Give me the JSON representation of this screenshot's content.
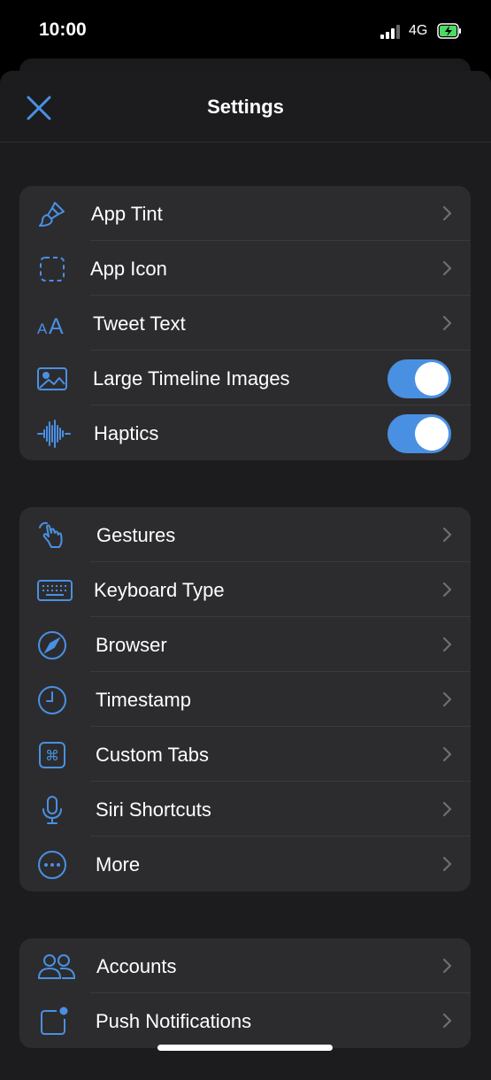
{
  "status": {
    "time": "10:00",
    "network": "4G"
  },
  "header": {
    "title": "Settings"
  },
  "groups": [
    {
      "items": [
        {
          "label": "App Tint",
          "icon": "paintbrush-icon",
          "accessory": "chevron"
        },
        {
          "label": "App Icon",
          "icon": "app-icon-outline-icon",
          "accessory": "chevron"
        },
        {
          "label": "Tweet Text",
          "icon": "text-size-icon",
          "accessory": "chevron"
        },
        {
          "label": "Large Timeline Images",
          "icon": "photo-icon",
          "accessory": "toggle",
          "on": true
        },
        {
          "label": "Haptics",
          "icon": "waveform-icon",
          "accessory": "toggle",
          "on": true
        }
      ]
    },
    {
      "items": [
        {
          "label": "Gestures",
          "icon": "hand-tap-icon",
          "accessory": "chevron"
        },
        {
          "label": "Keyboard Type",
          "icon": "keyboard-icon",
          "accessory": "chevron"
        },
        {
          "label": "Browser",
          "icon": "compass-icon",
          "accessory": "chevron"
        },
        {
          "label": "Timestamp",
          "icon": "clock-icon",
          "accessory": "chevron"
        },
        {
          "label": "Custom Tabs",
          "icon": "command-icon",
          "accessory": "chevron"
        },
        {
          "label": "Siri Shortcuts",
          "icon": "microphone-icon",
          "accessory": "chevron"
        },
        {
          "label": "More",
          "icon": "ellipsis-circle-icon",
          "accessory": "chevron"
        }
      ]
    },
    {
      "items": [
        {
          "label": "Accounts",
          "icon": "people-icon",
          "accessory": "chevron"
        },
        {
          "label": "Push Notifications",
          "icon": "notification-badge-icon",
          "accessory": "chevron"
        }
      ]
    }
  ],
  "colors": {
    "accent": "#4a90e2",
    "background": "#1c1c1e",
    "cell": "#2c2c2e"
  }
}
